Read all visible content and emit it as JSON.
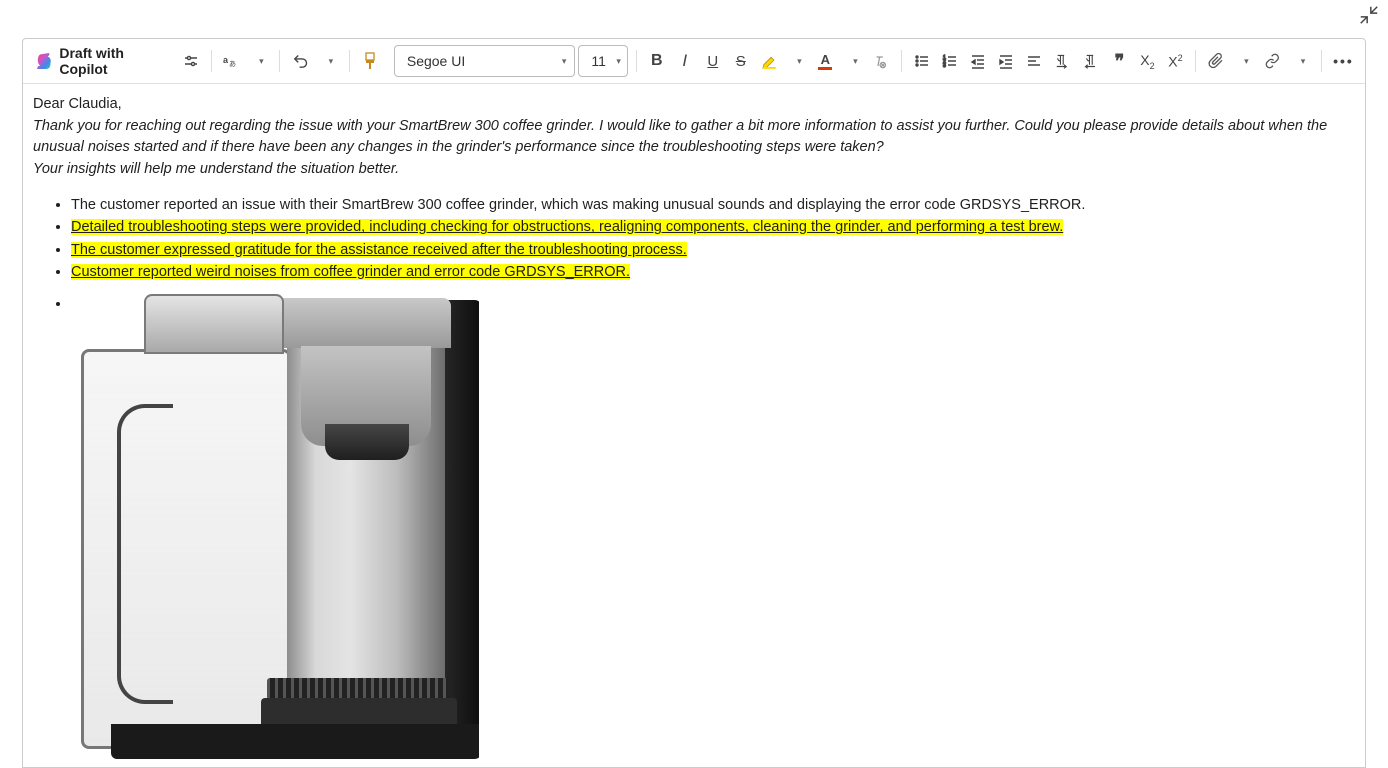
{
  "toolbar": {
    "copilot_label": "Draft with Copilot",
    "font_name": "Segoe UI",
    "font_size": "11"
  },
  "email": {
    "greeting": "Dear Claudia,",
    "para1": "Thank you for reaching out regarding the issue with your SmartBrew 300 coffee grinder. I would like to gather a bit more information to assist you further. Could you please provide details about when the unusual noises started and if there have been any changes in the grinder's performance since the troubleshooting steps were taken?",
    "para2": "Your insights will help me understand the situation better.",
    "bullets": [
      "The customer reported an issue with their SmartBrew 300 coffee grinder, which was making unusual sounds and displaying the error code GRDSYS_ERROR.",
      "Detailed troubleshooting steps were provided, including checking for obstructions, realigning components, cleaning the grinder, and performing a test brew.",
      "The customer expressed gratitude for the assistance received after the troubleshooting process.",
      "Customer reported weird noises from coffee grinder and error code GRDSYS_ERROR."
    ]
  }
}
